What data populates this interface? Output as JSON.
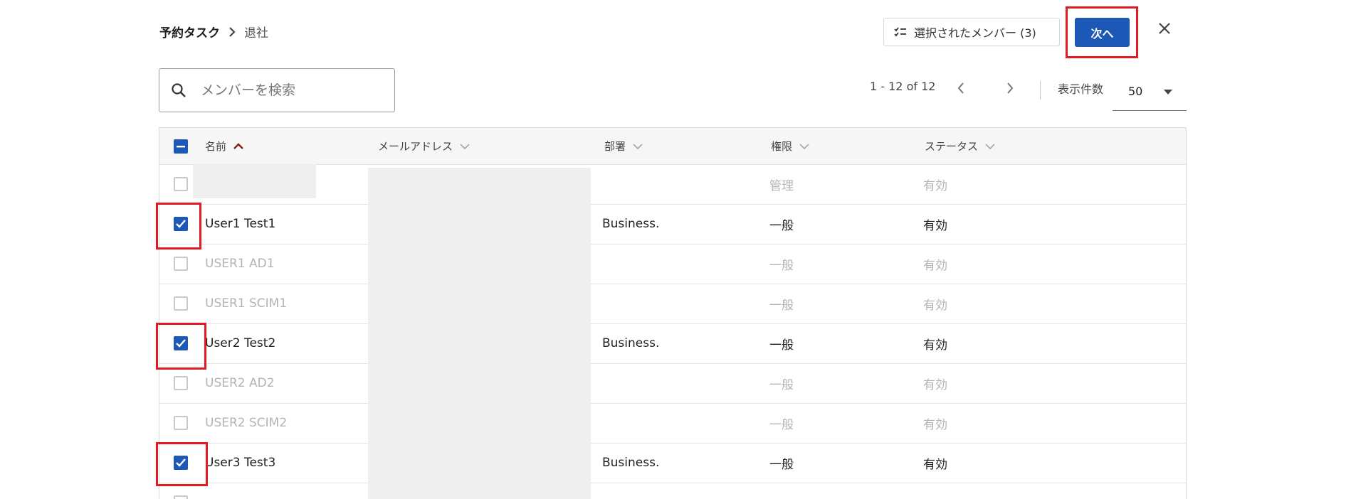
{
  "breadcrumb": {
    "root": "予約タスク",
    "current": "退社"
  },
  "header": {
    "selected_members_label": "選択されたメンバー (3)",
    "next_label": "次へ"
  },
  "search": {
    "placeholder": "メンバーを検索",
    "value": ""
  },
  "pagination": {
    "range_text": "1 - 12 of 12",
    "per_page_label": "表示件数",
    "per_page_value": "50"
  },
  "table": {
    "columns": {
      "name": "名前",
      "email": "メールアドレス",
      "department": "部署",
      "role": "権限",
      "status": "ステータス"
    },
    "rows": [
      {
        "name": "",
        "department": "",
        "role": "管理",
        "status": "有効"
      },
      {
        "name": "User1 Test1",
        "department": "Business.",
        "role": "一般",
        "status": "有効"
      },
      {
        "name": "USER1 AD1",
        "department": "",
        "role": "一般",
        "status": "有効"
      },
      {
        "name": "USER1 SCIM1",
        "department": "",
        "role": "一般",
        "status": "有効"
      },
      {
        "name": "User2 Test2",
        "department": "Business.",
        "role": "一般",
        "status": "有効"
      },
      {
        "name": "USER2 AD2",
        "department": "",
        "role": "一般",
        "status": "有効"
      },
      {
        "name": "USER2 SCIM2",
        "department": "",
        "role": "一般",
        "status": "有効"
      },
      {
        "name": "User3 Test3",
        "department": "Business.",
        "role": "一般",
        "status": "有効"
      }
    ]
  },
  "colors": {
    "primary": "#1c58b5",
    "highlight": "#e01b24",
    "disabled_text": "#b3b3b3",
    "sort_active": "#8b1c1c"
  }
}
